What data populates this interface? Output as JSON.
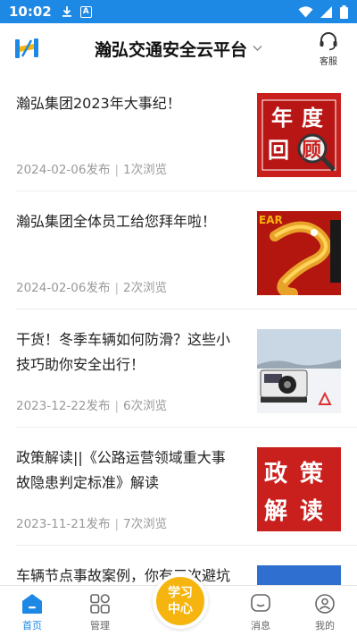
{
  "status_bar": {
    "time": "10:02",
    "letter_icon": "A"
  },
  "header": {
    "title": "瀚弘交通安全云平台",
    "service_label": "客服"
  },
  "news": [
    {
      "title": "瀚弘集团2023年大事纪！",
      "date": "2024-02-06发布",
      "views": "1次浏览",
      "thumb_text": [
        "年",
        "度",
        "回",
        "顾"
      ]
    },
    {
      "title": "瀚弘集团全体员工给您拜年啦！",
      "date": "2024-02-06发布",
      "views": "2次浏览",
      "thumb_text": [
        "EAR"
      ]
    },
    {
      "title": "干货！冬季车辆如何防滑？这些小技巧助你安全出行！",
      "date": "2023-12-22发布",
      "views": "6次浏览"
    },
    {
      "title": "政策解读||《公路运营领域重大事故隐患判定标准》解读",
      "date": "2023-11-21发布",
      "views": "7次浏览",
      "thumb_text": [
        "政",
        "策",
        "解",
        "读"
      ]
    },
    {
      "title": "车辆节点事故案例，你有三次避坑",
      "date": "",
      "views": ""
    }
  ],
  "nav": {
    "home": "首页",
    "manage": "管理",
    "center_line1": "学习",
    "center_line2": "中心",
    "messages": "消息",
    "mine": "我的"
  },
  "colors": {
    "primary": "#1e88e5",
    "accent": "#f6b40e",
    "red": "#c9201e"
  },
  "icons": [
    "download-icon",
    "a-letter-icon",
    "wifi-icon",
    "signal-icon",
    "battery-icon",
    "app-logo-icon",
    "chevron-down-icon",
    "headset-icon",
    "home-icon",
    "grid-icon",
    "chat-icon",
    "user-icon"
  ]
}
